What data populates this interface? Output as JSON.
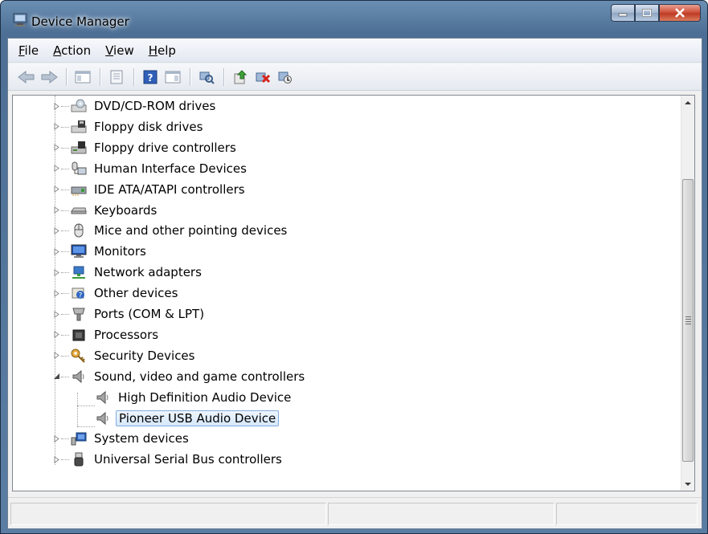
{
  "window": {
    "title": "Device Manager",
    "buttons": [
      "minimize-button",
      "maximize-button",
      "close-button"
    ]
  },
  "menu": [
    {
      "label": "ile",
      "mnemonic": "F"
    },
    {
      "label": "ction",
      "mnemonic": "A"
    },
    {
      "label": "iew",
      "mnemonic": "V"
    },
    {
      "label": "elp",
      "mnemonic": "H"
    }
  ],
  "toolbar": {
    "buttons": [
      "back-icon",
      "forward-icon",
      "show-hide-console-tree-icon",
      "properties-icon",
      "help-icon",
      "action-pane-icon",
      "scan-hardware-icon",
      "update-driver-icon",
      "uninstall-icon",
      "disable-device-icon"
    ]
  },
  "tree": {
    "items": [
      {
        "label": "DVD/CD-ROM drives",
        "icon": "dvd-drive-icon",
        "level": 1,
        "expanded": false
      },
      {
        "label": "Floppy disk drives",
        "icon": "floppy-drive-icon",
        "level": 1,
        "expanded": false
      },
      {
        "label": "Floppy drive controllers",
        "icon": "floppy-controller-icon",
        "level": 1,
        "expanded": false
      },
      {
        "label": "Human Interface Devices",
        "icon": "hid-icon",
        "level": 1,
        "expanded": false
      },
      {
        "label": "IDE ATA/ATAPI controllers",
        "icon": "ide-controller-icon",
        "level": 1,
        "expanded": false
      },
      {
        "label": "Keyboards",
        "icon": "keyboard-icon",
        "level": 1,
        "expanded": false
      },
      {
        "label": "Mice and other pointing devices",
        "icon": "mouse-icon",
        "level": 1,
        "expanded": false
      },
      {
        "label": "Monitors",
        "icon": "monitor-icon",
        "level": 1,
        "expanded": false
      },
      {
        "label": "Network adapters",
        "icon": "network-adapter-icon",
        "level": 1,
        "expanded": false
      },
      {
        "label": "Other devices",
        "icon": "unknown-device-icon",
        "level": 1,
        "expanded": false
      },
      {
        "label": "Ports (COM & LPT)",
        "icon": "port-icon",
        "level": 1,
        "expanded": false
      },
      {
        "label": "Processors",
        "icon": "processor-icon",
        "level": 1,
        "expanded": false
      },
      {
        "label": "Security Devices",
        "icon": "security-key-icon",
        "level": 1,
        "expanded": false
      },
      {
        "label": "Sound, video and game controllers",
        "icon": "speaker-icon",
        "level": 1,
        "expanded": true
      },
      {
        "label": "High Definition Audio Device",
        "icon": "speaker-icon",
        "level": 2,
        "expanded": null
      },
      {
        "label": "Pioneer USB Audio Device",
        "icon": "speaker-icon",
        "level": 2,
        "expanded": null,
        "selected": true
      },
      {
        "label": "System devices",
        "icon": "system-device-icon",
        "level": 1,
        "expanded": false
      },
      {
        "label": "Universal Serial Bus controllers",
        "icon": "usb-icon",
        "level": 1,
        "expanded": false
      }
    ]
  },
  "colors": {
    "selection_border": "#84acdd",
    "selection_fill": "#d6e8fb",
    "title_bar": "#5a7da3",
    "close_button": "#c03a24"
  }
}
